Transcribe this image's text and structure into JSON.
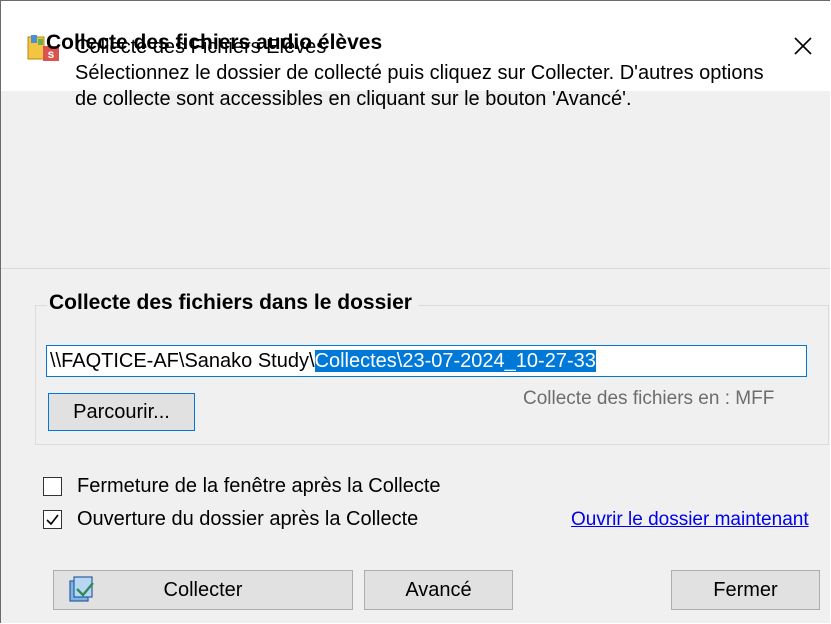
{
  "window": {
    "title": "Collecte des Fichiers Elèves",
    "icon": "sanako-app-icon",
    "close_icon": "close-icon"
  },
  "header": {
    "title": "Collecte des fichiers audio élèves",
    "description": "Sélectionnez le dossier de collecté puis cliquez sur Collecter. D'autres options de collecte sont accessibles en cliquant sur le bouton 'Avancé'."
  },
  "folder_group": {
    "label": "Collecte des fichiers dans le dossier",
    "path_prefix": "\\\\FAQTICE-AF\\Sanako Study\\",
    "path_selected": "Collectes\\23-07-2024_10-27-33",
    "browse_label": "Parcourir...",
    "format_text": "Collecte des fichiers en : MFF"
  },
  "options": {
    "close_after": {
      "label": "Fermeture de la fenêtre après la Collecte",
      "checked": false
    },
    "open_after": {
      "label": "Ouverture du dossier après la Collecte",
      "checked": true
    },
    "open_now_link": "Ouvrir le dossier maintenant"
  },
  "buttons": {
    "collect": "Collecter",
    "advanced": "Avancé",
    "close": "Fermer"
  },
  "colors": {
    "accent": "#0078d7",
    "link": "#0000ee",
    "dialog_bg": "#f0f0f0"
  }
}
